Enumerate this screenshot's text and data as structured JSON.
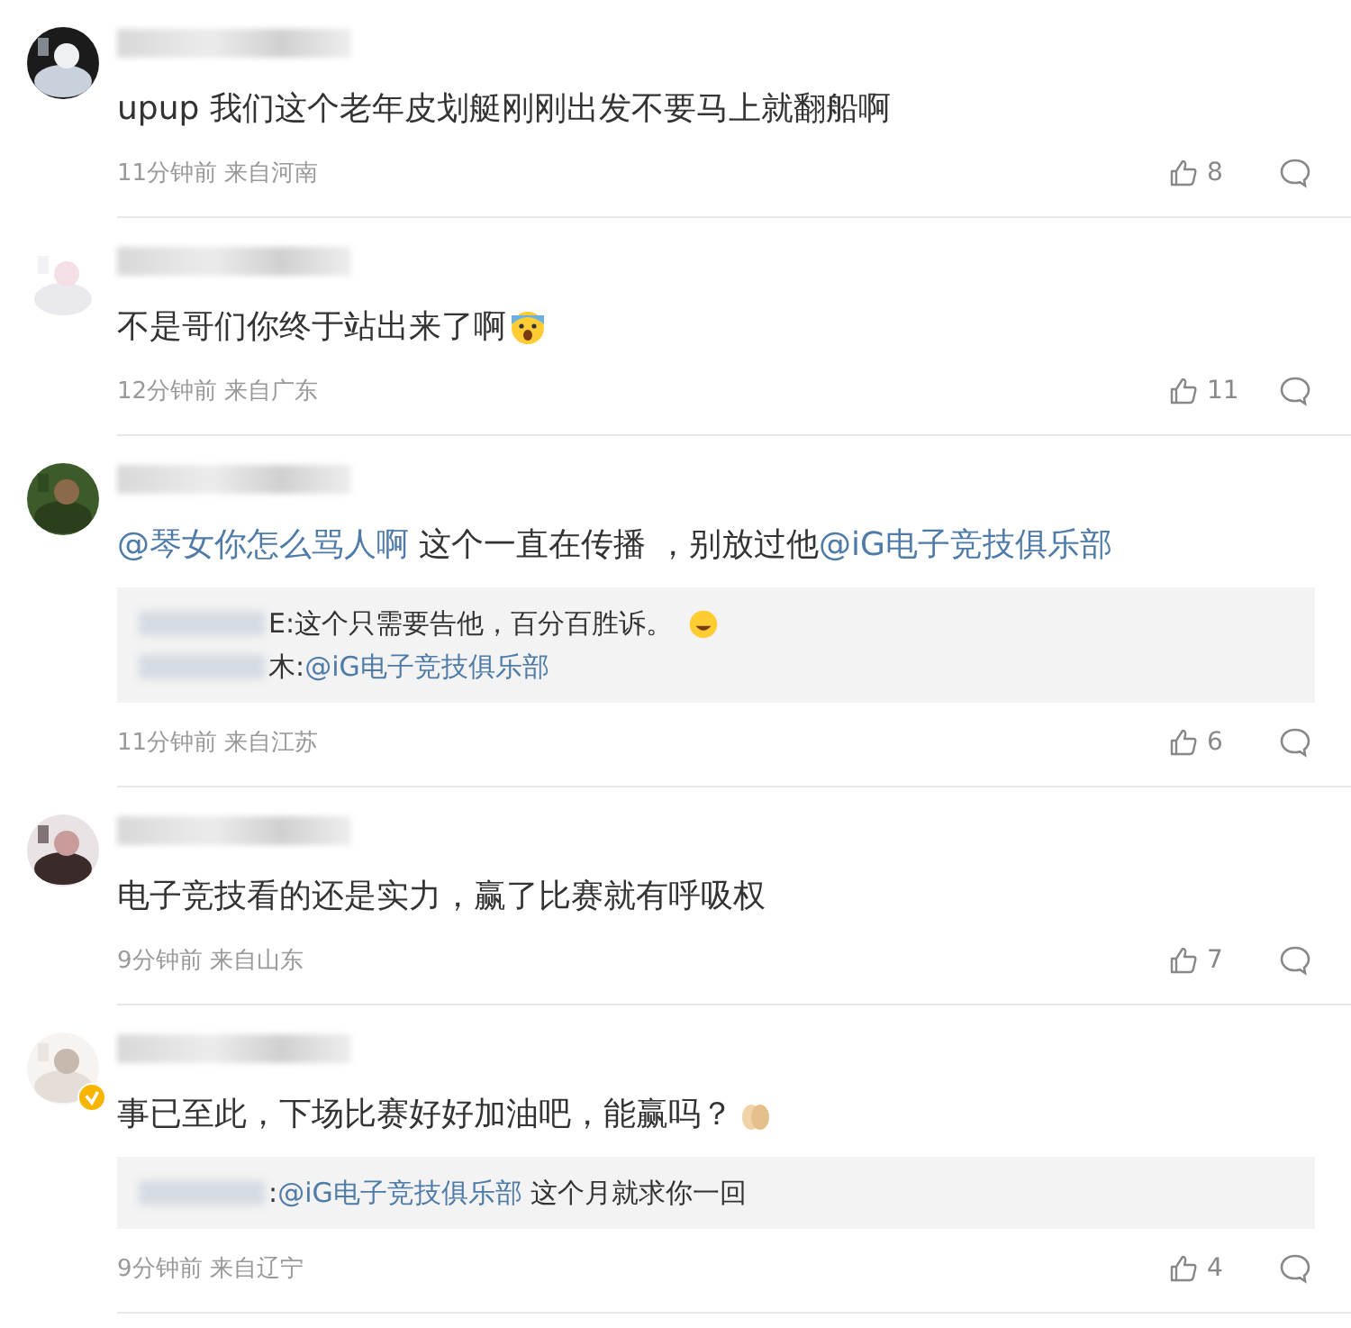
{
  "comments": [
    {
      "verified": false,
      "content": [
        {
          "kind": "plain",
          "text": "upup 我们这个老年皮划艇刚刚出发不要马上就翻船啊"
        }
      ],
      "time": "11分钟前",
      "location": "来自河南",
      "likes": "8"
    },
    {
      "verified": false,
      "content": [
        {
          "kind": "plain",
          "text": "不是哥们你终于站出来了啊"
        },
        {
          "kind": "scared_emoji"
        }
      ],
      "time": "12分钟前",
      "location": "来自广东",
      "likes": "11"
    },
    {
      "verified": false,
      "content": [
        {
          "kind": "mention",
          "text": "@琴女你怎么骂人啊"
        },
        {
          "kind": "plain",
          "text": " 这个一直在传播 ，别放过他"
        },
        {
          "kind": "mention",
          "text": "@iG电子竞技俱乐部"
        }
      ],
      "replies": [
        {
          "segments": [
            {
              "kind": "plain",
              "text": "E:这个只需要告他，百分百胜诉。"
            },
            {
              "kind": "laugh_emoji"
            }
          ]
        },
        {
          "segments": [
            {
              "kind": "plain",
              "text": "木:"
            },
            {
              "kind": "mention",
              "text": "@iG电子竞技俱乐部"
            }
          ]
        }
      ],
      "time": "11分钟前",
      "location": "来自江苏",
      "likes": "6"
    },
    {
      "verified": false,
      "content": [
        {
          "kind": "plain",
          "text": "电子竞技看的还是实力，赢了比赛就有呼吸权"
        }
      ],
      "time": "9分钟前",
      "location": "来自山东",
      "likes": "7"
    },
    {
      "verified": true,
      "content": [
        {
          "kind": "plain",
          "text": "事已至此，下场比赛好好加油吧，能赢吗？"
        },
        {
          "kind": "hands_emoji"
        }
      ],
      "replies": [
        {
          "segments": [
            {
              "kind": "plain",
              "text": ":"
            },
            {
              "kind": "mention",
              "text": "@iG电子竞技俱乐部"
            },
            {
              "kind": "plain",
              "text": " 这个月就求你一回"
            }
          ]
        }
      ],
      "time": "9分钟前",
      "location": "来自辽宁",
      "likes": "4"
    }
  ]
}
